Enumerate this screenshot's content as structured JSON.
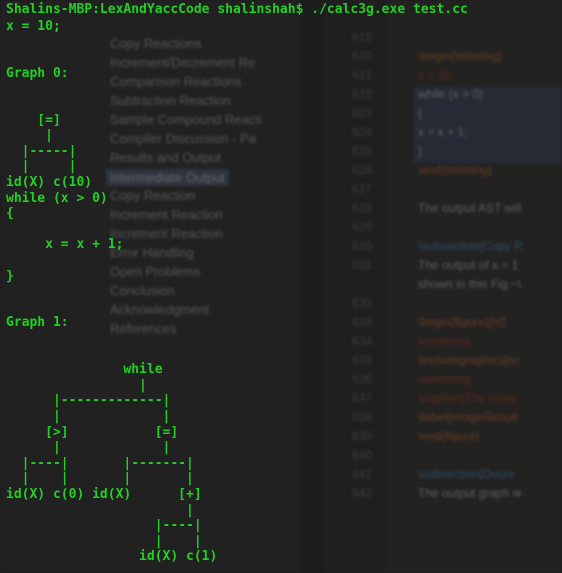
{
  "terminal": {
    "prompt": "Shalins-MBP:LexAndYaccCode shalinshah$ ./calc3g.exe test.cc",
    "lines": [
      "x = 10;",
      "",
      "",
      "Graph 0:",
      "",
      "",
      "    [=]",
      "     |",
      "  |-----|",
      "  |     |",
      "id(X) c(10)",
      "while (x > 0)",
      "{",
      "",
      "     x = x + 1;",
      "",
      "}",
      "",
      "",
      "Graph 1:",
      "",
      "",
      "               while",
      "                 |",
      "      |-------------|",
      "      |             |",
      "     [>]           [=]",
      "      |             |",
      "  |----|       |-------|",
      "  |    |       |       |",
      "id(X) c(0) id(X)      [+]",
      "                       |",
      "                   |----|",
      "                   |    |",
      "                 id(X) c(1)"
    ]
  },
  "outline": {
    "items": [
      "Copy Reactions",
      "Increment/Decrement Re",
      "Comparison Reactions",
      "Subtraction Reaction",
      "Sample Compound Reacti",
      "Compiler Discussion - Pa",
      "Results and Output",
      "Intermediate Output",
      "Copy Reaction",
      "Increment Reaction",
      "Increment Reaction",
      "Error Handling",
      "Open Problems",
      "Conclusion",
      "Acknowledgment",
      "References"
    ],
    "selected_index": 7
  },
  "editor": {
    "line_numbers": [
      "619",
      "620",
      "621",
      "622",
      "623",
      "624",
      "625",
      "626",
      "627",
      "628",
      "629",
      "630",
      "631",
      "",
      "632",
      "633",
      "634",
      "635",
      "636",
      "637",
      "638",
      "639",
      "640",
      "641",
      "642"
    ],
    "code_lines": [
      {
        "text": "",
        "color": "#cfcfcf"
      },
      {
        "text": "\\begin{lstlisting}",
        "color": "#e07a3a"
      },
      {
        "text": "x = 10;",
        "color": "#c84a2a"
      },
      {
        "text": "while (x > 0)",
        "color": "#d8d8d8"
      },
      {
        "text": "{",
        "color": "#d8d8d8"
      },
      {
        "text": "   x = x + 1;",
        "color": "#d8d8d8"
      },
      {
        "text": "}",
        "color": "#d8d8d8"
      },
      {
        "text": "\\end{lstlisting}",
        "color": "#e07a3a"
      },
      {
        "text": "",
        "color": "#cfcfcf"
      },
      {
        "text": "The output AST will",
        "color": "#cfcfcf"
      },
      {
        "text": "",
        "color": "#cfcfcf"
      },
      {
        "text": "\\subsection{Copy R",
        "color": "#5aa0e0"
      },
      {
        "text": "The output of x = 1",
        "color": "#cfcfcf"
      },
      {
        "text": "shown in this Fig.~\\",
        "color": "#cfcfcf"
      },
      {
        "text": "",
        "color": "#cfcfcf"
      },
      {
        "text": "\\begin{figure}[ht]",
        "color": "#e07a3a"
      },
      {
        "text": "\\centering",
        "color": "#c84a2a"
      },
      {
        "text": "\\includegraphics[sc",
        "color": "#e07a3a"
      },
      {
        "text": "\\centering",
        "color": "#c84a2a"
      },
      {
        "text": "\\caption{The value",
        "color": "#c84a2a"
      },
      {
        "text": "\\label{imageResult",
        "color": "#e07a3a"
      },
      {
        "text": "\\end{figure}",
        "color": "#e07a3a"
      },
      {
        "text": "",
        "color": "#cfcfcf"
      },
      {
        "text": "\\subsection{Decre",
        "color": "#5aa0e0"
      },
      {
        "text": "The output graph w",
        "color": "#cfcfcf"
      }
    ]
  }
}
